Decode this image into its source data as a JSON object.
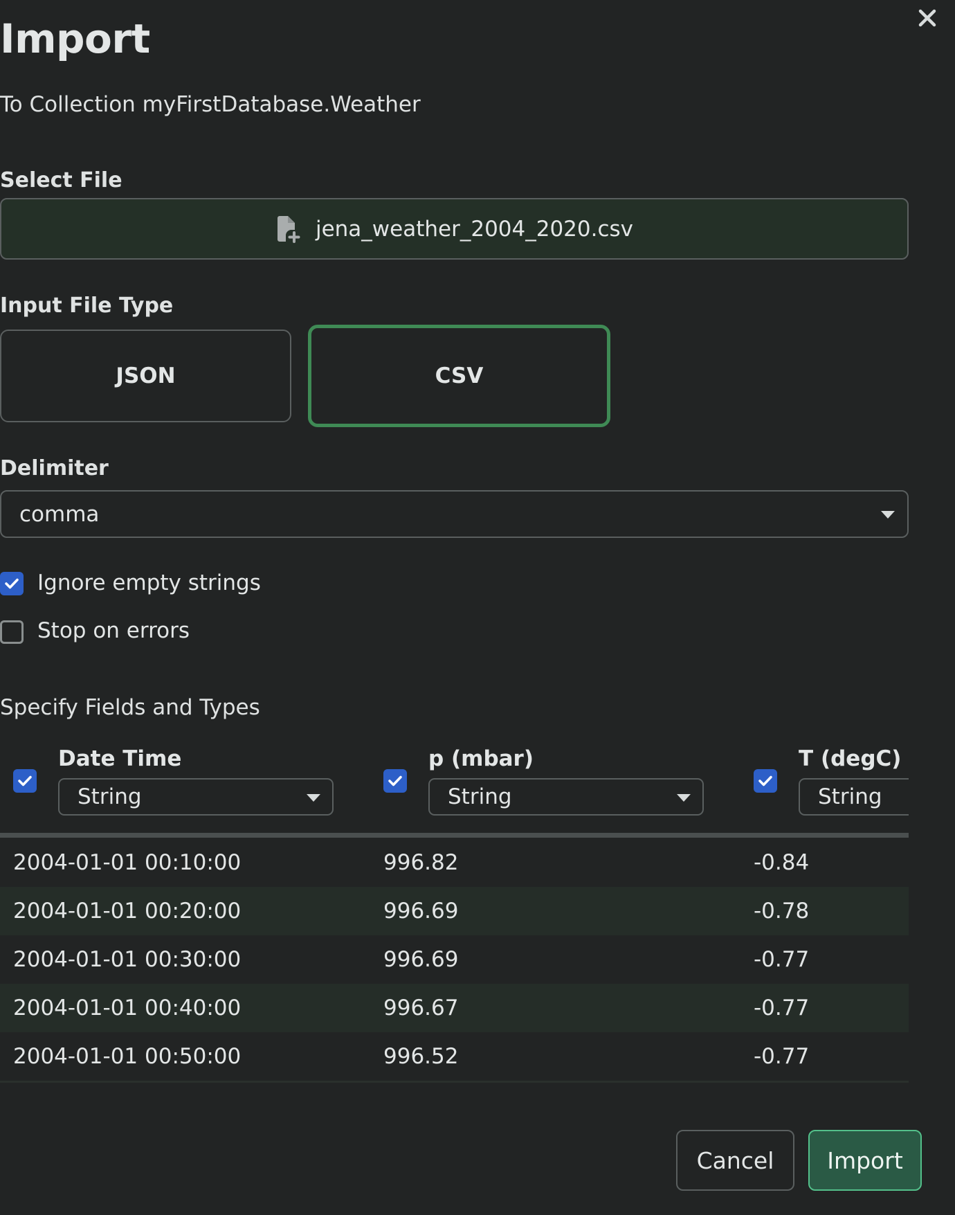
{
  "dialog": {
    "title": "Import",
    "subtitle": "To Collection myFirstDatabase.Weather",
    "close_icon": "close-icon"
  },
  "select_file": {
    "label": "Select File",
    "file_name": "jena_weather_2004_2020.csv",
    "icon": "file-add-icon"
  },
  "input_file_type": {
    "label": "Input File Type",
    "options": [
      "JSON",
      "CSV"
    ],
    "selected": "CSV"
  },
  "delimiter": {
    "label": "Delimiter",
    "value": "comma"
  },
  "options": {
    "ignore_empty_strings": {
      "label": "Ignore empty strings",
      "checked": true
    },
    "stop_on_errors": {
      "label": "Stop on errors",
      "checked": false
    }
  },
  "fields": {
    "title": "Specify Fields and Types",
    "columns": [
      {
        "name": "Date Time",
        "type": "String",
        "checked": true
      },
      {
        "name": "p (mbar)",
        "type": "String",
        "checked": true
      },
      {
        "name": "T (degC)",
        "type": "String",
        "checked": true
      }
    ],
    "rows": [
      [
        "2004-01-01 00:10:00",
        "996.82",
        "-0.84"
      ],
      [
        "2004-01-01 00:20:00",
        "996.69",
        "-0.78"
      ],
      [
        "2004-01-01 00:30:00",
        "996.69",
        "-0.77"
      ],
      [
        "2004-01-01 00:40:00",
        "996.67",
        "-0.77"
      ],
      [
        "2004-01-01 00:50:00",
        "996.52",
        "-0.77"
      ]
    ]
  },
  "actions": {
    "cancel_label": "Cancel",
    "import_label": "Import"
  },
  "colors": {
    "background": "#222424",
    "selected_border": "#3f8a55",
    "checkbox": "#2d5fc8",
    "import_button": "#2a5a45",
    "import_border": "#53c08a"
  }
}
